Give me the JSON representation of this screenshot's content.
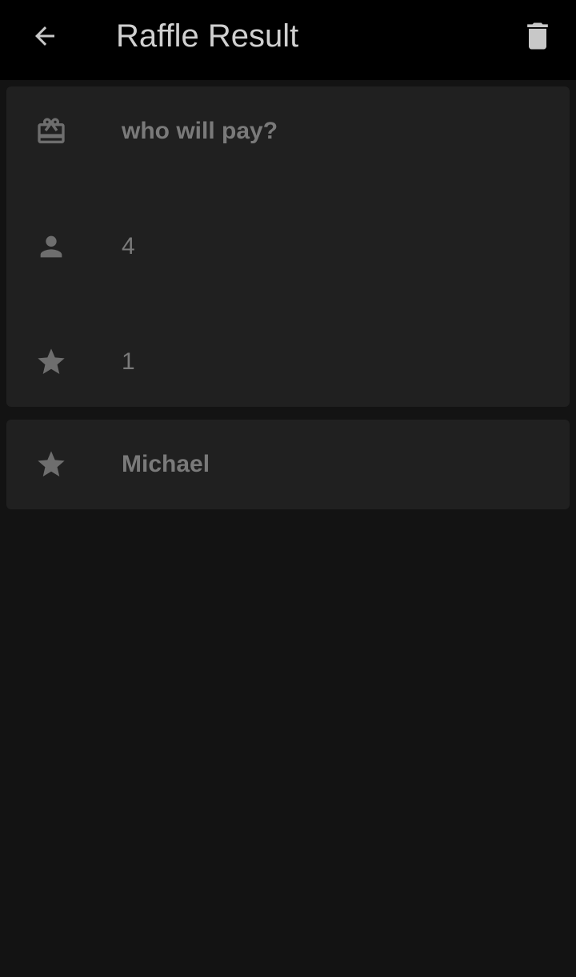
{
  "app_bar": {
    "title": "Raffle Result",
    "back_icon": "arrow-back-icon",
    "delete_icon": "trash-icon"
  },
  "raffle_info": {
    "name": {
      "icon": "gift-card-icon",
      "value": "who will pay?"
    },
    "participants": {
      "icon": "person-icon",
      "value": "4"
    },
    "winners_count": {
      "icon": "star-icon",
      "value": "1"
    }
  },
  "results": [
    {
      "icon": "star-icon",
      "name": "Michael"
    }
  ],
  "colors": {
    "background": "#131313",
    "app_bar": "#000000",
    "card": "#202020",
    "text": "#7a7a7a",
    "title": "#d0d0d0",
    "icon": "#6e6e6e"
  }
}
